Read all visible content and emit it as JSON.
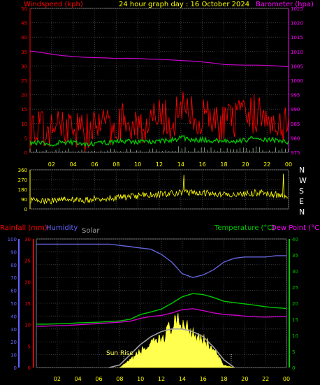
{
  "header": {
    "left": "Windspeed (kph)",
    "center": "24 hour graph day : 16 October 2024",
    "right": "Barometer (hpa)"
  },
  "panel2": {
    "compass": [
      "N",
      "W",
      "S",
      "E",
      "N"
    ]
  },
  "panel3": {
    "labels": [
      "Rainfall (mm)",
      "Humidity",
      "Solar",
      "Temperature (°C)",
      "Dew Point (°C)"
    ],
    "annotation": "Sun Rise"
  },
  "colors": {
    "wind": "#ff0000",
    "gust_avg": "#00c800",
    "barometer": "#c800c8",
    "direction": "#ffff00",
    "humidity": "#6464dc",
    "solar_line": "#a0a0a0",
    "solar_fill": "#ffff50",
    "temperature": "#00c800",
    "dewpoint": "#c800c8",
    "rain_axis": "#ff0000",
    "humidity_axis": "#6464ff",
    "temp_axis": "#00c800",
    "baro_axis": "#ff00ff"
  },
  "chart_data": [
    {
      "type": "line",
      "name": "wind-barometer",
      "x_ticks": [
        "02",
        "04",
        "06",
        "08",
        "10",
        "12",
        "14",
        "16",
        "18",
        "20",
        "22",
        "00"
      ],
      "xlim_hours": [
        0,
        24
      ],
      "ylim_left": [
        0,
        50
      ],
      "y_ticks_left": [
        "0",
        "5",
        "10",
        "15",
        "20",
        "25",
        "30",
        "35",
        "40",
        "45",
        "50"
      ],
      "ylim_right": [
        975,
        1025
      ],
      "y_ticks_right": [
        "975",
        "980",
        "985",
        "990",
        "995",
        "1000",
        "1005",
        "1010",
        "1015",
        "1020",
        "1025"
      ],
      "series": [
        {
          "name": "Windspeed (kph)",
          "axis": "left",
          "hours": [
            0,
            1,
            2,
            3,
            4,
            5,
            6,
            7,
            8,
            9,
            10,
            11,
            12,
            13,
            14,
            15,
            16,
            17,
            18,
            19,
            20,
            21,
            22,
            23,
            24
          ],
          "values": [
            9,
            8,
            7,
            10,
            9,
            7,
            8,
            9,
            10,
            11,
            10,
            9,
            12,
            11,
            15,
            13,
            12,
            11,
            10,
            11,
            12,
            14,
            13,
            11,
            10
          ]
        },
        {
          "name": "Barometer (hpa)",
          "axis": "right",
          "hours": [
            0,
            1,
            2,
            3,
            4,
            5,
            6,
            7,
            8,
            9,
            10,
            11,
            12,
            13,
            14,
            15,
            16,
            17,
            18,
            19,
            20,
            21,
            22,
            23,
            24
          ],
          "values": [
            1010.2,
            1009.7,
            1009.1,
            1008.6,
            1008.3,
            1008.0,
            1007.9,
            1007.8,
            1007.6,
            1007.7,
            1007.6,
            1007.4,
            1007.3,
            1007.1,
            1006.9,
            1006.7,
            1006.4,
            1006.0,
            1005.5,
            1005.4,
            1005.3,
            1005.3,
            1005.2,
            1005.0,
            1004.7
          ]
        }
      ]
    },
    {
      "type": "line",
      "name": "wind-direction",
      "x_ticks": [
        "02",
        "04",
        "06",
        "08",
        "10",
        "12",
        "14",
        "16",
        "18",
        "20",
        "22",
        "00"
      ],
      "xlim_hours": [
        0,
        24
      ],
      "ylim": [
        0,
        360
      ],
      "y_ticks": [
        "0",
        "90",
        "180",
        "270",
        "360"
      ],
      "series": [
        {
          "name": "Direction",
          "hours": [
            0,
            1,
            2,
            3,
            4,
            5,
            6,
            7,
            8,
            9,
            10,
            11,
            12,
            13,
            14,
            15,
            16,
            17,
            18,
            19,
            20,
            21,
            22,
            23,
            24
          ],
          "values": [
            80,
            70,
            75,
            100,
            85,
            80,
            95,
            100,
            105,
            110,
            120,
            130,
            135,
            140,
            150,
            150,
            145,
            140,
            130,
            135,
            140,
            150,
            140,
            130,
            120
          ]
        }
      ]
    },
    {
      "type": "line",
      "name": "temp-humidity-solar",
      "x_ticks": [
        "02",
        "04",
        "06",
        "08",
        "10",
        "12",
        "14",
        "16",
        "18",
        "20",
        "22",
        "00"
      ],
      "xlim_hours": [
        0,
        24
      ],
      "ylim_humidity": [
        0,
        100
      ],
      "y_ticks_humidity": [
        "0",
        "10",
        "20",
        "30",
        "40",
        "50",
        "60",
        "70",
        "80",
        "90",
        "100"
      ],
      "ylim_rain": [
        0,
        30
      ],
      "y_ticks_rain": [
        "0",
        "5",
        "10",
        "15",
        "20",
        "25",
        "30"
      ],
      "ylim_temp": [
        0,
        40
      ],
      "y_ticks_temp": [
        "0",
        "5",
        "10",
        "15",
        "20",
        "25",
        "30",
        "35",
        "40"
      ],
      "series": [
        {
          "name": "Humidity",
          "axis": "humidity",
          "hours": [
            0,
            1,
            2,
            3,
            4,
            5,
            6,
            7,
            8,
            9,
            10,
            11,
            12,
            13,
            14,
            15,
            16,
            17,
            18,
            19,
            20,
            21,
            22,
            23,
            24
          ],
          "values": [
            96,
            96,
            96,
            96,
            96,
            96,
            96,
            96,
            95,
            94,
            93,
            92,
            88,
            82,
            73,
            70,
            72,
            76,
            82,
            85,
            86,
            86,
            86,
            87,
            87
          ]
        },
        {
          "name": "Temperature (°C)",
          "axis": "temp",
          "hours": [
            0,
            1,
            2,
            3,
            4,
            5,
            6,
            7,
            8,
            9,
            10,
            11,
            12,
            13,
            14,
            15,
            16,
            17,
            18,
            19,
            20,
            21,
            22,
            23,
            24
          ],
          "values": [
            13.5,
            13.5,
            13.6,
            13.7,
            13.9,
            14.0,
            14.1,
            14.3,
            14.5,
            15.0,
            16.5,
            17.3,
            18.2,
            20.0,
            22.0,
            23.0,
            22.7,
            21.8,
            20.6,
            20.2,
            19.8,
            19.4,
            18.9,
            18.6,
            18.4
          ]
        },
        {
          "name": "Dew Point (°C)",
          "axis": "temp",
          "hours": [
            0,
            1,
            2,
            3,
            4,
            5,
            6,
            7,
            8,
            9,
            10,
            11,
            12,
            13,
            14,
            15,
            16,
            17,
            18,
            19,
            20,
            21,
            22,
            23,
            24
          ],
          "values": [
            12.8,
            12.9,
            13.0,
            13.1,
            13.3,
            13.5,
            13.7,
            13.9,
            14.1,
            14.4,
            15.3,
            15.9,
            16.2,
            17.0,
            18.0,
            18.3,
            17.7,
            17.0,
            16.5,
            16.3,
            16.0,
            15.8,
            15.7,
            15.8,
            15.9
          ]
        },
        {
          "name": "Solar",
          "axis": "humidity",
          "hours": [
            8,
            9,
            10,
            11,
            12,
            13,
            14,
            15,
            16,
            17,
            18,
            19
          ],
          "values": [
            0,
            6,
            14,
            19,
            24,
            35,
            38,
            31,
            24,
            15,
            2,
            0
          ]
        },
        {
          "name": "Solar clear-sky",
          "axis": "humidity",
          "hours": [
            7,
            8,
            9,
            10,
            11,
            12,
            13,
            14,
            15,
            16,
            17,
            18,
            19
          ],
          "values": [
            0,
            2,
            10,
            18,
            24,
            28,
            30,
            30,
            28,
            24,
            16,
            6,
            0
          ]
        }
      ]
    }
  ]
}
